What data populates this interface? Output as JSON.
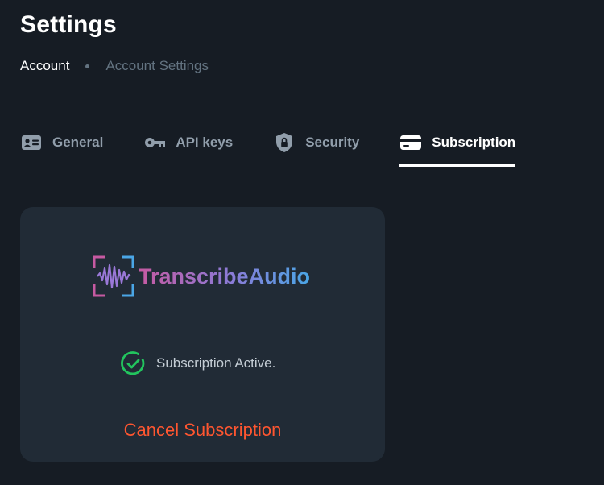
{
  "page": {
    "title": "Settings"
  },
  "breadcrumb": {
    "root": "Account",
    "current": "Account Settings"
  },
  "tabs": [
    {
      "label": "General",
      "icon": "id-card-icon"
    },
    {
      "label": "API keys",
      "icon": "key-icon"
    },
    {
      "label": "Security",
      "icon": "shield-lock-icon"
    },
    {
      "label": "Subscription",
      "icon": "credit-card-icon",
      "active": true
    }
  ],
  "subscription": {
    "brand_name": "TranscribeAudio",
    "status_text": "Subscription Active.",
    "cancel_label": "Cancel Subscription"
  },
  "colors": {
    "background": "#161c24",
    "card": "#212b36",
    "active_check": "#22c55e",
    "cancel": "#ff5630",
    "inactive_tab": "#919eab"
  }
}
